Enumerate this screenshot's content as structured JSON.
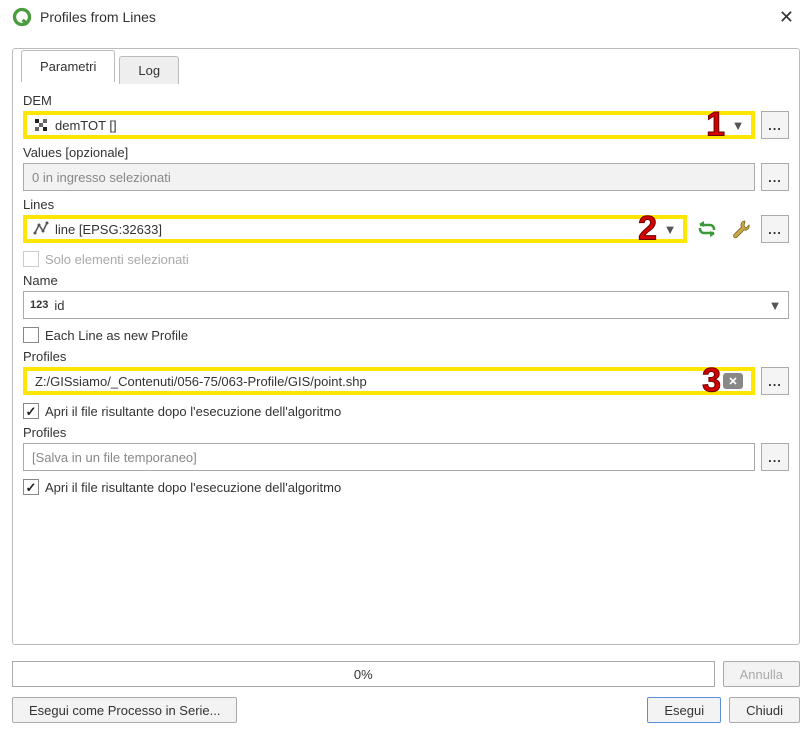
{
  "window": {
    "title": "Profiles from Lines"
  },
  "tabs": {
    "parametri": "Parametri",
    "log": "Log"
  },
  "dem": {
    "label": "DEM",
    "value": "demTOT []",
    "annotation": "1"
  },
  "values": {
    "label": "Values [opzionale]",
    "placeholder": "0 in ingresso selezionati"
  },
  "lines": {
    "label": "Lines",
    "value": "line [EPSG:32633]",
    "annotation": "2",
    "selection_only": "Solo elementi selezionati"
  },
  "name": {
    "label": "Name",
    "prefix": "123",
    "value": "id"
  },
  "each_line": {
    "label": "Each Line as new Profile"
  },
  "profiles1": {
    "label": "Profiles",
    "value": "Z:/GISsiamo/_Contenuti/056-75/063-Profile/GIS/point.shp",
    "annotation": "3",
    "open_after": "Apri il file risultante dopo l'esecuzione dell'algoritmo"
  },
  "profiles2": {
    "label": "Profiles",
    "placeholder": "[Salva in un file temporaneo]",
    "open_after": "Apri il file risultante dopo l'esecuzione dell'algoritmo"
  },
  "footer": {
    "progress": "0%",
    "cancel": "Annulla",
    "batch": "Esegui come Processo in Serie...",
    "run": "Esegui",
    "close": "Chiudi"
  }
}
